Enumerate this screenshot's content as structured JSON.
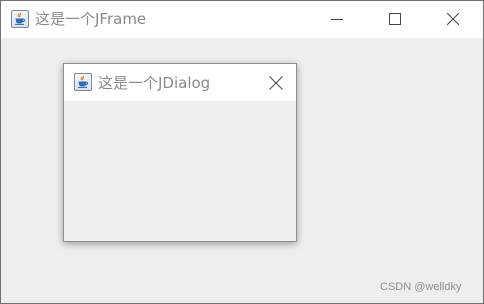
{
  "frame": {
    "title": "这是一个JFrame",
    "icon": "java-cup-icon",
    "controls": {
      "minimize_icon": "minimize-icon",
      "maximize_icon": "maximize-icon",
      "close_icon": "close-icon"
    }
  },
  "dialog": {
    "title": "这是一个JDialog",
    "icon": "java-cup-icon",
    "close_icon": "close-icon"
  },
  "watermark": "CSDN @welldky",
  "colors": {
    "titlebar_bg": "#ffffff",
    "content_bg": "#eeeeee",
    "title_text": "#8a8a8a",
    "frame_border": "#707070"
  }
}
